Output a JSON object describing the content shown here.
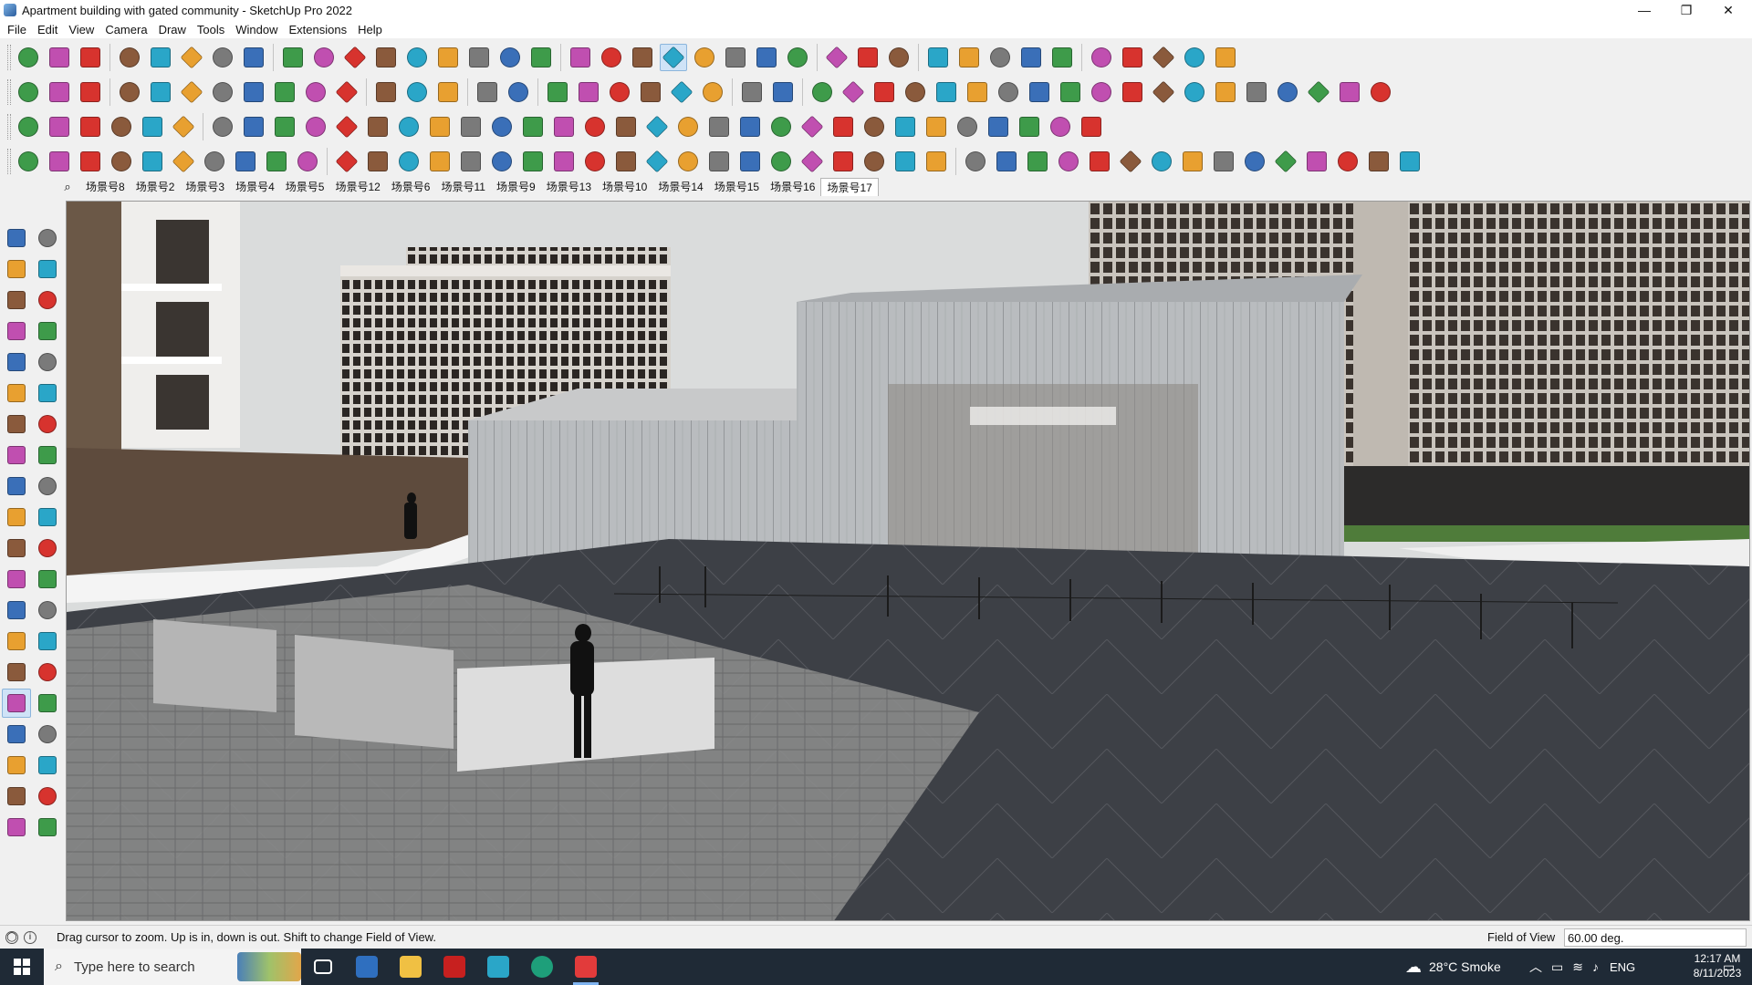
{
  "window": {
    "title": "Apartment building with gated community - SketchUp Pro 2022",
    "controls": [
      "—",
      "❐",
      "✕"
    ]
  },
  "menu": [
    "File",
    "Edit",
    "View",
    "Camera",
    "Draw",
    "Tools",
    "Window",
    "Extensions",
    "Help"
  ],
  "toolbars": {
    "row1_icons": [
      "zoom-extents",
      "select",
      "select-dropdown",
      "eraser",
      "line",
      "line-dropdown",
      "freehand",
      "freehand-dropdown",
      "circle",
      "circle-dropdown",
      "push-pull",
      "follow-me",
      "move",
      "rotate",
      "scale",
      "tape-measure",
      "text",
      "paint-bucket",
      "orbit",
      "pan",
      "zoom",
      "zoom-window",
      "iso-view",
      "top-view",
      "front-view",
      "right-view",
      "user-account",
      "user-dropdown",
      "layers",
      "sandbox-a",
      "sandbox-b",
      "arrows-up",
      "arrows-down",
      "section-plane",
      "section-fill",
      "undo",
      "redo",
      "extension"
    ],
    "row2_icons": [
      "component-a",
      "component-b",
      "component-c",
      "extrude-a",
      "extrude-b",
      "extrude-c",
      "extrude-d",
      "extrude-e",
      "extrude-f",
      "extrude-g",
      "curve",
      "plane-a",
      "plane-b",
      "plane-c",
      "box-a",
      "box-b",
      "house-a",
      "house-b",
      "house-c",
      "house-d",
      "house-e",
      "fx",
      "pill",
      "pencil-tool",
      "shape-a",
      "shape-b",
      "shape-c",
      "shape-d",
      "shape-e",
      "shape-f",
      "shape-g",
      "shape-h",
      "shape-i",
      "shape-j",
      "shape-k",
      "shape-l",
      "shape-m",
      "shape-n",
      "shape-o",
      "shape-p",
      "shape-q",
      "shape-r",
      "shape-s"
    ],
    "row3_icons": [
      "layer-a",
      "layer-b",
      "layer-c",
      "layer-d",
      "layer-e",
      "layer-f",
      "loop",
      "stairs",
      "corner",
      "chain",
      "tool-a",
      "tool-b",
      "tool-c",
      "tool-d",
      "tool-e",
      "tool-f",
      "tool-g",
      "tool-h",
      "tool-i",
      "tool-j",
      "tool-k",
      "tool-l",
      "tool-m",
      "tool-n",
      "tool-o",
      "tool-p",
      "tool-q",
      "tool-r",
      "tool-s",
      "tool-t",
      "tool-u",
      "tool-v",
      "tool-w",
      "tool-x",
      "tool-y"
    ],
    "row4_icons": [
      "edit-a",
      "edit-b",
      "edit-c",
      "edit-d",
      "edit-e",
      "edit-f",
      "edit-g",
      "edit-h",
      "edit-i",
      "edit-j",
      "edit-k",
      "edit-l",
      "edit-m",
      "edit-n",
      "edit-o",
      "edit-p",
      "edit-q",
      "edit-r",
      "edit-s",
      "edit-t",
      "edit-u",
      "edit-v",
      "edit-w",
      "edit-x",
      "edit-y",
      "edit-z",
      "edit-aa",
      "edit-ab",
      "edit-ac",
      "edit-ad",
      "edit-ae",
      "edit-af",
      "edit-ag",
      "edit-ah",
      "edit-ai",
      "edit-aj",
      "edit-ak",
      "edit-al",
      "edit-am",
      "edit-an",
      "edit-ao",
      "edit-ap",
      "edit-aq",
      "edit-ar",
      "edit-as"
    ]
  },
  "scenes": {
    "search_icon": "⌕",
    "tabs": [
      "场景号8",
      "场景号2",
      "场景号3",
      "场景号4",
      "场景号5",
      "场景号12",
      "场景号6",
      "场景号11",
      "场景号9",
      "场景号13",
      "场景号10",
      "场景号14",
      "场景号15",
      "场景号16",
      "场景号17"
    ],
    "active": "场景号17"
  },
  "left_tools": [
    "select",
    "orbit",
    "paint",
    "eraser",
    "component",
    "tape",
    "line",
    "freehand",
    "rectangle",
    "rotated-rect",
    "circle",
    "polygon",
    "arc",
    "arc-2pt",
    "arc-3pt",
    "pie",
    "move",
    "push-pull",
    "rotate",
    "follow-me",
    "scale",
    "offset",
    "tape-measure",
    "dimension",
    "protractor",
    "text",
    "axes",
    "3d-text",
    "orbit-2",
    "pan",
    "zoom",
    "zoom-window",
    "zoom-extents",
    "previous",
    "position-camera",
    "look-around",
    "walk",
    "section-plane",
    "iso",
    "top"
  ],
  "status": {
    "hint": "Drag cursor to zoom.  Up is in, down is out. Shift to change Field of View.",
    "vcb_label": "Field of View",
    "vcb_value": "60.00 deg."
  },
  "taskbar": {
    "search_placeholder": "Type here to search",
    "weather": "28°C  Smoke",
    "lang": "ENG",
    "time": "12:17 AM",
    "date": "8/11/2023"
  },
  "colors": {
    "accent": "#cfe3f7",
    "sky": "#d9dcdc",
    "ground": "#3b3e44",
    "taskbar": "#1f2a36"
  }
}
